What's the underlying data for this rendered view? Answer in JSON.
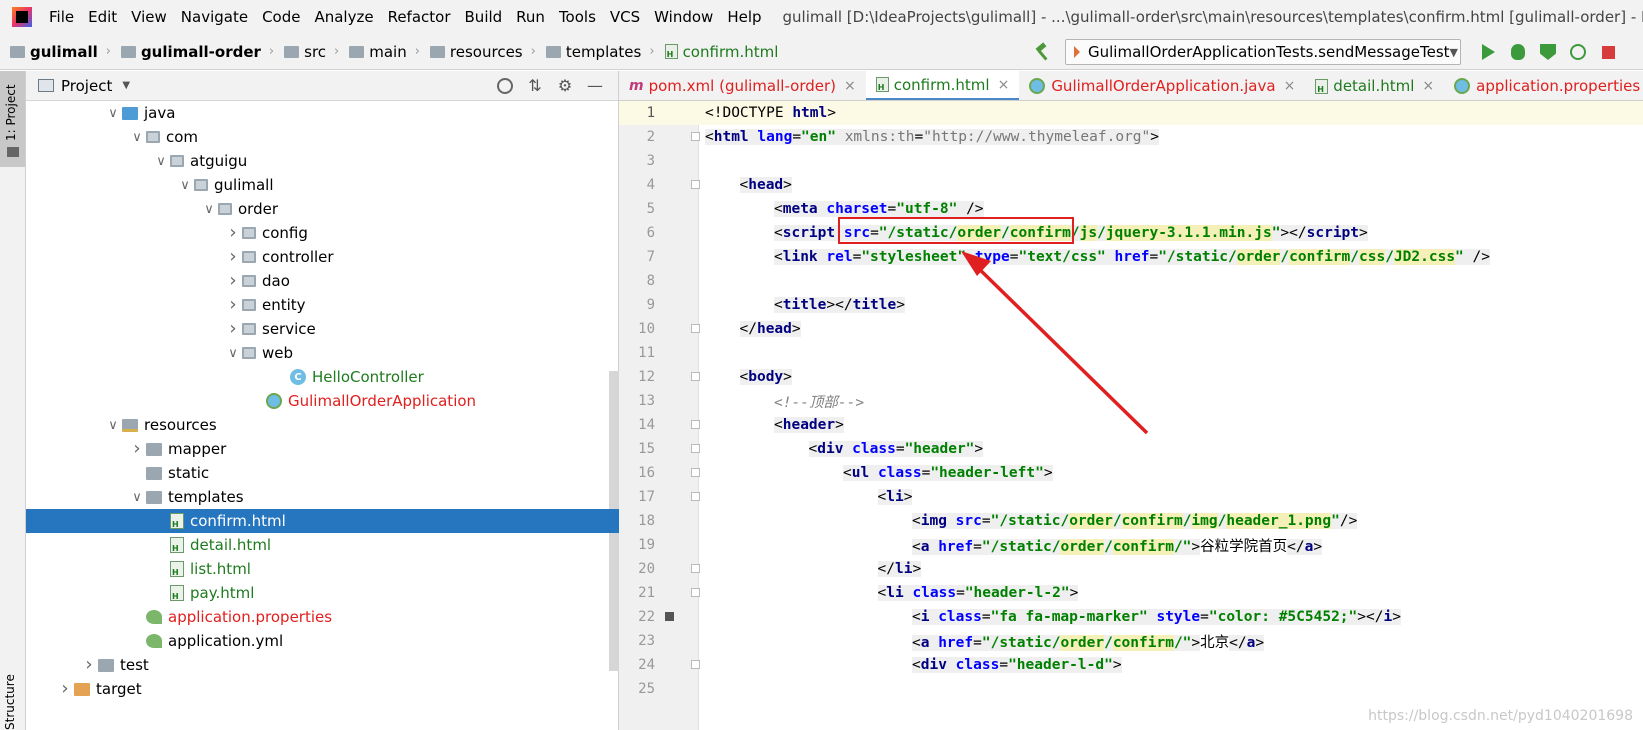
{
  "menubar": {
    "items": [
      "File",
      "Edit",
      "View",
      "Navigate",
      "Code",
      "Analyze",
      "Refactor",
      "Build",
      "Run",
      "Tools",
      "VCS",
      "Window",
      "Help"
    ],
    "window_title": "gulimall [D:\\IdeaProjects\\gulimall] - ...\\gulimall-order\\src\\main\\resources\\templates\\confirm.html [gulimall-order] - Int"
  },
  "breadcrumb": {
    "items": [
      "gulimall",
      "gulimall-order",
      "src",
      "main",
      "resources",
      "templates"
    ],
    "file": "confirm.html"
  },
  "run_config": {
    "label": "GulimallOrderApplicationTests.sendMessageTest"
  },
  "toolstrip": {
    "project_label": "1: Project",
    "structure_label": "Structure"
  },
  "project_panel": {
    "title": "Project",
    "tree": [
      {
        "label": "java",
        "state": "exp",
        "icon": "folder-src",
        "depth": 4
      },
      {
        "label": "com",
        "state": "exp",
        "icon": "pkg",
        "depth": 5
      },
      {
        "label": "atguigu",
        "state": "exp",
        "icon": "pkg",
        "depth": 6
      },
      {
        "label": "gulimall",
        "state": "exp",
        "icon": "pkg",
        "depth": 7
      },
      {
        "label": "order",
        "state": "exp",
        "icon": "pkg",
        "depth": 8
      },
      {
        "label": "config",
        "state": "col",
        "icon": "pkg",
        "depth": 9
      },
      {
        "label": "controller",
        "state": "col",
        "icon": "pkg",
        "depth": 9
      },
      {
        "label": "dao",
        "state": "col",
        "icon": "pkg",
        "depth": 9
      },
      {
        "label": "entity",
        "state": "col",
        "icon": "pkg",
        "depth": 9
      },
      {
        "label": "service",
        "state": "col",
        "icon": "pkg",
        "depth": 9
      },
      {
        "label": "web",
        "state": "exp",
        "icon": "pkg",
        "depth": 9
      },
      {
        "label": "HelloController",
        "state": "none",
        "icon": "class",
        "depth": 11,
        "color": "green"
      },
      {
        "label": "GulimallOrderApplication",
        "state": "none",
        "icon": "spring",
        "depth": 10,
        "color": "red"
      },
      {
        "label": "resources",
        "state": "exp",
        "icon": "folder-res",
        "depth": 4
      },
      {
        "label": "mapper",
        "state": "col",
        "icon": "folder",
        "depth": 5
      },
      {
        "label": "static",
        "state": "none",
        "icon": "folder",
        "depth": 5
      },
      {
        "label": "templates",
        "state": "exp",
        "icon": "folder",
        "depth": 5
      },
      {
        "label": "confirm.html",
        "state": "none",
        "icon": "html",
        "depth": 6,
        "color": "green",
        "selected": true
      },
      {
        "label": "detail.html",
        "state": "none",
        "icon": "html",
        "depth": 6,
        "color": "green"
      },
      {
        "label": "list.html",
        "state": "none",
        "icon": "html",
        "depth": 6,
        "color": "green"
      },
      {
        "label": "pay.html",
        "state": "none",
        "icon": "html",
        "depth": 6,
        "color": "green"
      },
      {
        "label": "application.properties",
        "state": "none",
        "icon": "props",
        "depth": 5,
        "color": "red"
      },
      {
        "label": "application.yml",
        "state": "none",
        "icon": "props",
        "depth": 5
      },
      {
        "label": "test",
        "state": "col",
        "icon": "folder",
        "depth": 3
      },
      {
        "label": "target",
        "state": "col",
        "icon": "folder-target",
        "depth": 2
      }
    ]
  },
  "tabs": [
    {
      "label": "pom.xml (gulimall-order)",
      "icon": "m",
      "color": "red"
    },
    {
      "label": "confirm.html",
      "icon": "html",
      "color": "green",
      "active": true
    },
    {
      "label": "GulimallOrderApplication.java",
      "icon": "j",
      "color": "red"
    },
    {
      "label": "detail.html",
      "icon": "html",
      "color": "green"
    },
    {
      "label": "application.properties",
      "icon": "j",
      "color": "red"
    }
  ],
  "editor": {
    "lines": [
      {
        "n": 1,
        "indent": 0,
        "html": "&lt;!DOCTYPE <span class='tag'>html</span>&gt;",
        "current": true
      },
      {
        "n": 2,
        "indent": 0,
        "html": "<span class='tag-bg'>&lt;<span class='tag'>html</span> <span class='attr'>lang</span>=<span class='val'>\"en\"</span> <span class='attr-g'>xmlns:th</span>=<span class='attr-g'>\"http://www.thymeleaf.org\"</span>&gt;</span>",
        "fold": true
      },
      {
        "n": 3,
        "indent": 0,
        "html": ""
      },
      {
        "n": 4,
        "indent": 1,
        "html": "<span class='tag-bg'>&lt;<span class='tag'>head</span>&gt;</span>",
        "fold": true
      },
      {
        "n": 5,
        "indent": 2,
        "html": "<span class='tag-bg'>&lt;<span class='tag'>meta</span> <span class='attr'>charset</span>=<span class='val'>\"utf-8\"</span> /&gt;</span>"
      },
      {
        "n": 6,
        "indent": 2,
        "html": "<span class='tag-bg'>&lt;<span class='tag'>script</span> <span class='attr'>src</span>=<span class='val'>\"/static/<span class='hl'>order</span>/<span class='hl'>confirm</span>/<span class='hl'>js</span>/<span class='hl'>jquery-3.1.1.min.js</span>\"</span>&gt;&lt;/<span class='tag'>script</span>&gt;</span>"
      },
      {
        "n": 7,
        "indent": 2,
        "html": "<span class='tag-bg'>&lt;<span class='tag'>link</span> <span class='attr'>rel</span>=<span class='val'>\"stylesheet\"</span> <span class='attr'>type</span>=<span class='val'>\"text/css\"</span> <span class='attr'>href</span>=<span class='val'>\"/static/<span class='hl'>order</span>/<span class='hl'>confirm</span>/<span class='hl'>css</span>/<span class='hl'>JD2.css</span>\"</span> /&gt;</span>"
      },
      {
        "n": 8,
        "indent": 0,
        "html": ""
      },
      {
        "n": 9,
        "indent": 2,
        "html": "<span class='tag-bg'>&lt;<span class='tag'>title</span>&gt;&lt;/<span class='tag'>title</span>&gt;</span>"
      },
      {
        "n": 10,
        "indent": 1,
        "html": "<span class='tag-bg'>&lt;/<span class='tag'>head</span>&gt;</span>",
        "fold": true
      },
      {
        "n": 11,
        "indent": 0,
        "html": ""
      },
      {
        "n": 12,
        "indent": 1,
        "html": "<span class='tag-bg'>&lt;<span class='tag'>body</span>&gt;</span>",
        "fold": true
      },
      {
        "n": 13,
        "indent": 2,
        "html": "<span class='cmt'>&lt;!--顶部--&gt;</span>"
      },
      {
        "n": 14,
        "indent": 2,
        "html": "<span class='tag-bg'>&lt;<span class='tag'>header</span>&gt;</span>",
        "fold": true
      },
      {
        "n": 15,
        "indent": 3,
        "html": "<span class='tag-bg'>&lt;<span class='tag'>div</span> <span class='attr'>class</span>=<span class='val'>\"header\"</span>&gt;</span>",
        "fold": true
      },
      {
        "n": 16,
        "indent": 4,
        "html": "<span class='tag-bg'>&lt;<span class='tag'>ul</span> <span class='attr'>class</span>=<span class='val'>\"header-left\"</span>&gt;</span>",
        "fold": true
      },
      {
        "n": 17,
        "indent": 5,
        "html": "<span class='tag-bg'>&lt;<span class='tag'>li</span>&gt;</span>",
        "fold": true
      },
      {
        "n": 18,
        "indent": 6,
        "html": "<span class='tag-bg'>&lt;<span class='tag'>img</span> <span class='attr'>src</span>=<span class='val'>\"/static/<span class='hl'>order</span>/<span class='hl'>confirm</span>/<span class='hl'>img</span>/<span class='hl'>header_1.png</span>\"</span>/&gt;</span>"
      },
      {
        "n": 19,
        "indent": 6,
        "html": "<span class='tag-bg'>&lt;<span class='tag'>a</span> <span class='attr'>href</span>=<span class='val'>\"/static/<span class='hl'>order</span>/<span class='hl'>confirm</span>/\"</span>&gt;</span><span class='ent'>谷粒学院首页</span><span class='tag-bg'>&lt;/<span class='tag'>a</span>&gt;</span>"
      },
      {
        "n": 20,
        "indent": 5,
        "html": "<span class='tag-bg'>&lt;/<span class='tag'>li</span>&gt;</span>",
        "fold": true
      },
      {
        "n": 21,
        "indent": 5,
        "html": "<span class='tag-bg'>&lt;<span class='tag'>li</span> <span class='attr'>class</span>=<span class='val'>\"header-l-2\"</span>&gt;</span>",
        "fold": true
      },
      {
        "n": 22,
        "indent": 6,
        "html": "<span class='tag-bg'>&lt;<span class='tag'>i</span> <span class='attr'>class</span>=<span class='val'>\"fa fa-map-marker\"</span> <span class='attr'>style</span>=<span class='val'>\"color: #5C5452;\"</span>&gt;&lt;/<span class='tag'>i</span>&gt;</span>",
        "bookmark": true
      },
      {
        "n": 23,
        "indent": 6,
        "html": "<span class='tag-bg'>&lt;<span class='tag'>a</span> <span class='attr'>href</span>=<span class='val'>\"/static/<span class='hl'>order</span>/<span class='hl'>confirm</span>/\"</span>&gt;</span><span class='ent'>北京</span><span class='tag-bg'>&lt;/<span class='tag'>a</span>&gt;</span>"
      },
      {
        "n": 24,
        "indent": 6,
        "html": "<span class='tag-bg'>&lt;<span class='tag'>div</span> <span class='attr'>class</span>=<span class='val'>\"header-l-d\"</span>&gt;</span>",
        "fold": true
      },
      {
        "n": 25,
        "indent": 0,
        "html": ""
      }
    ]
  },
  "watermark": "https://blog.csdn.net/pyd1040201698",
  "colors": {
    "selection": "#2675bf",
    "annotation_red": "#e02020",
    "tag_blue": "#000080",
    "attr_blue": "#0000ff",
    "value_green": "#008000"
  }
}
